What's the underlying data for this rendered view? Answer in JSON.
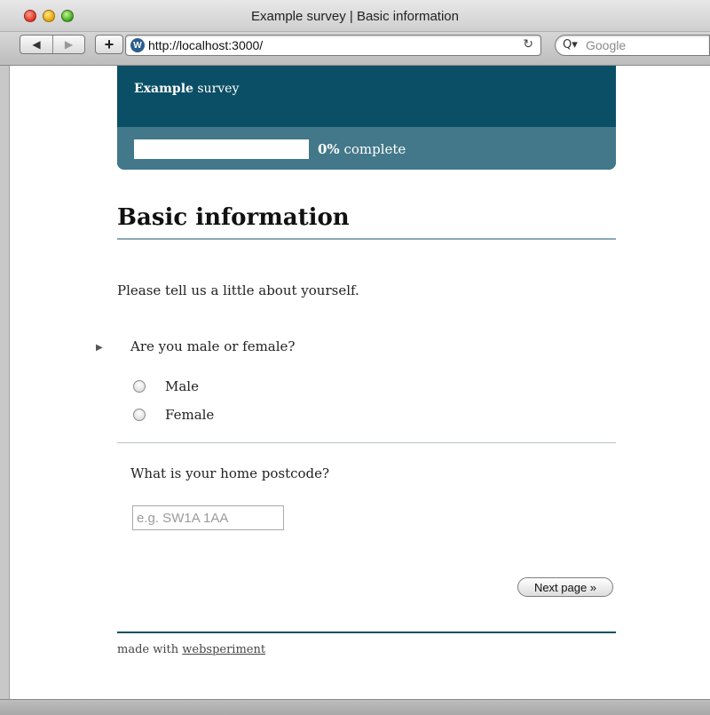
{
  "window": {
    "title": "Example survey | Basic information"
  },
  "toolbar": {
    "back_icon": "◀",
    "forward_icon": "▶",
    "add_bookmark": "+",
    "url": "http://localhost:3000/",
    "favicon_letter": "W",
    "reload_icon": "↻",
    "search_placeholder": "Google",
    "search_icon": "Q▾"
  },
  "survey": {
    "name_bold": "Example",
    "name_rest": " survey",
    "progress": {
      "percent_label": "0%",
      "suffix": " complete",
      "fraction": 0
    }
  },
  "page": {
    "title": "Basic information",
    "intro": "Please tell us a little about yourself."
  },
  "questions": {
    "gender": {
      "marker": "▶",
      "text": "Are you male or female?",
      "options": [
        "Male",
        "Female"
      ]
    },
    "postcode": {
      "text": "What is your home postcode?",
      "placeholder": "e.g. SW1A 1AA"
    }
  },
  "actions": {
    "next_label": "Next page »"
  },
  "footer": {
    "prefix": "made with ",
    "link": "websperiment"
  },
  "colors": {
    "header": "#0b4f66",
    "progress_strip": "#42788a",
    "title_rule": "#8aa9b6"
  }
}
